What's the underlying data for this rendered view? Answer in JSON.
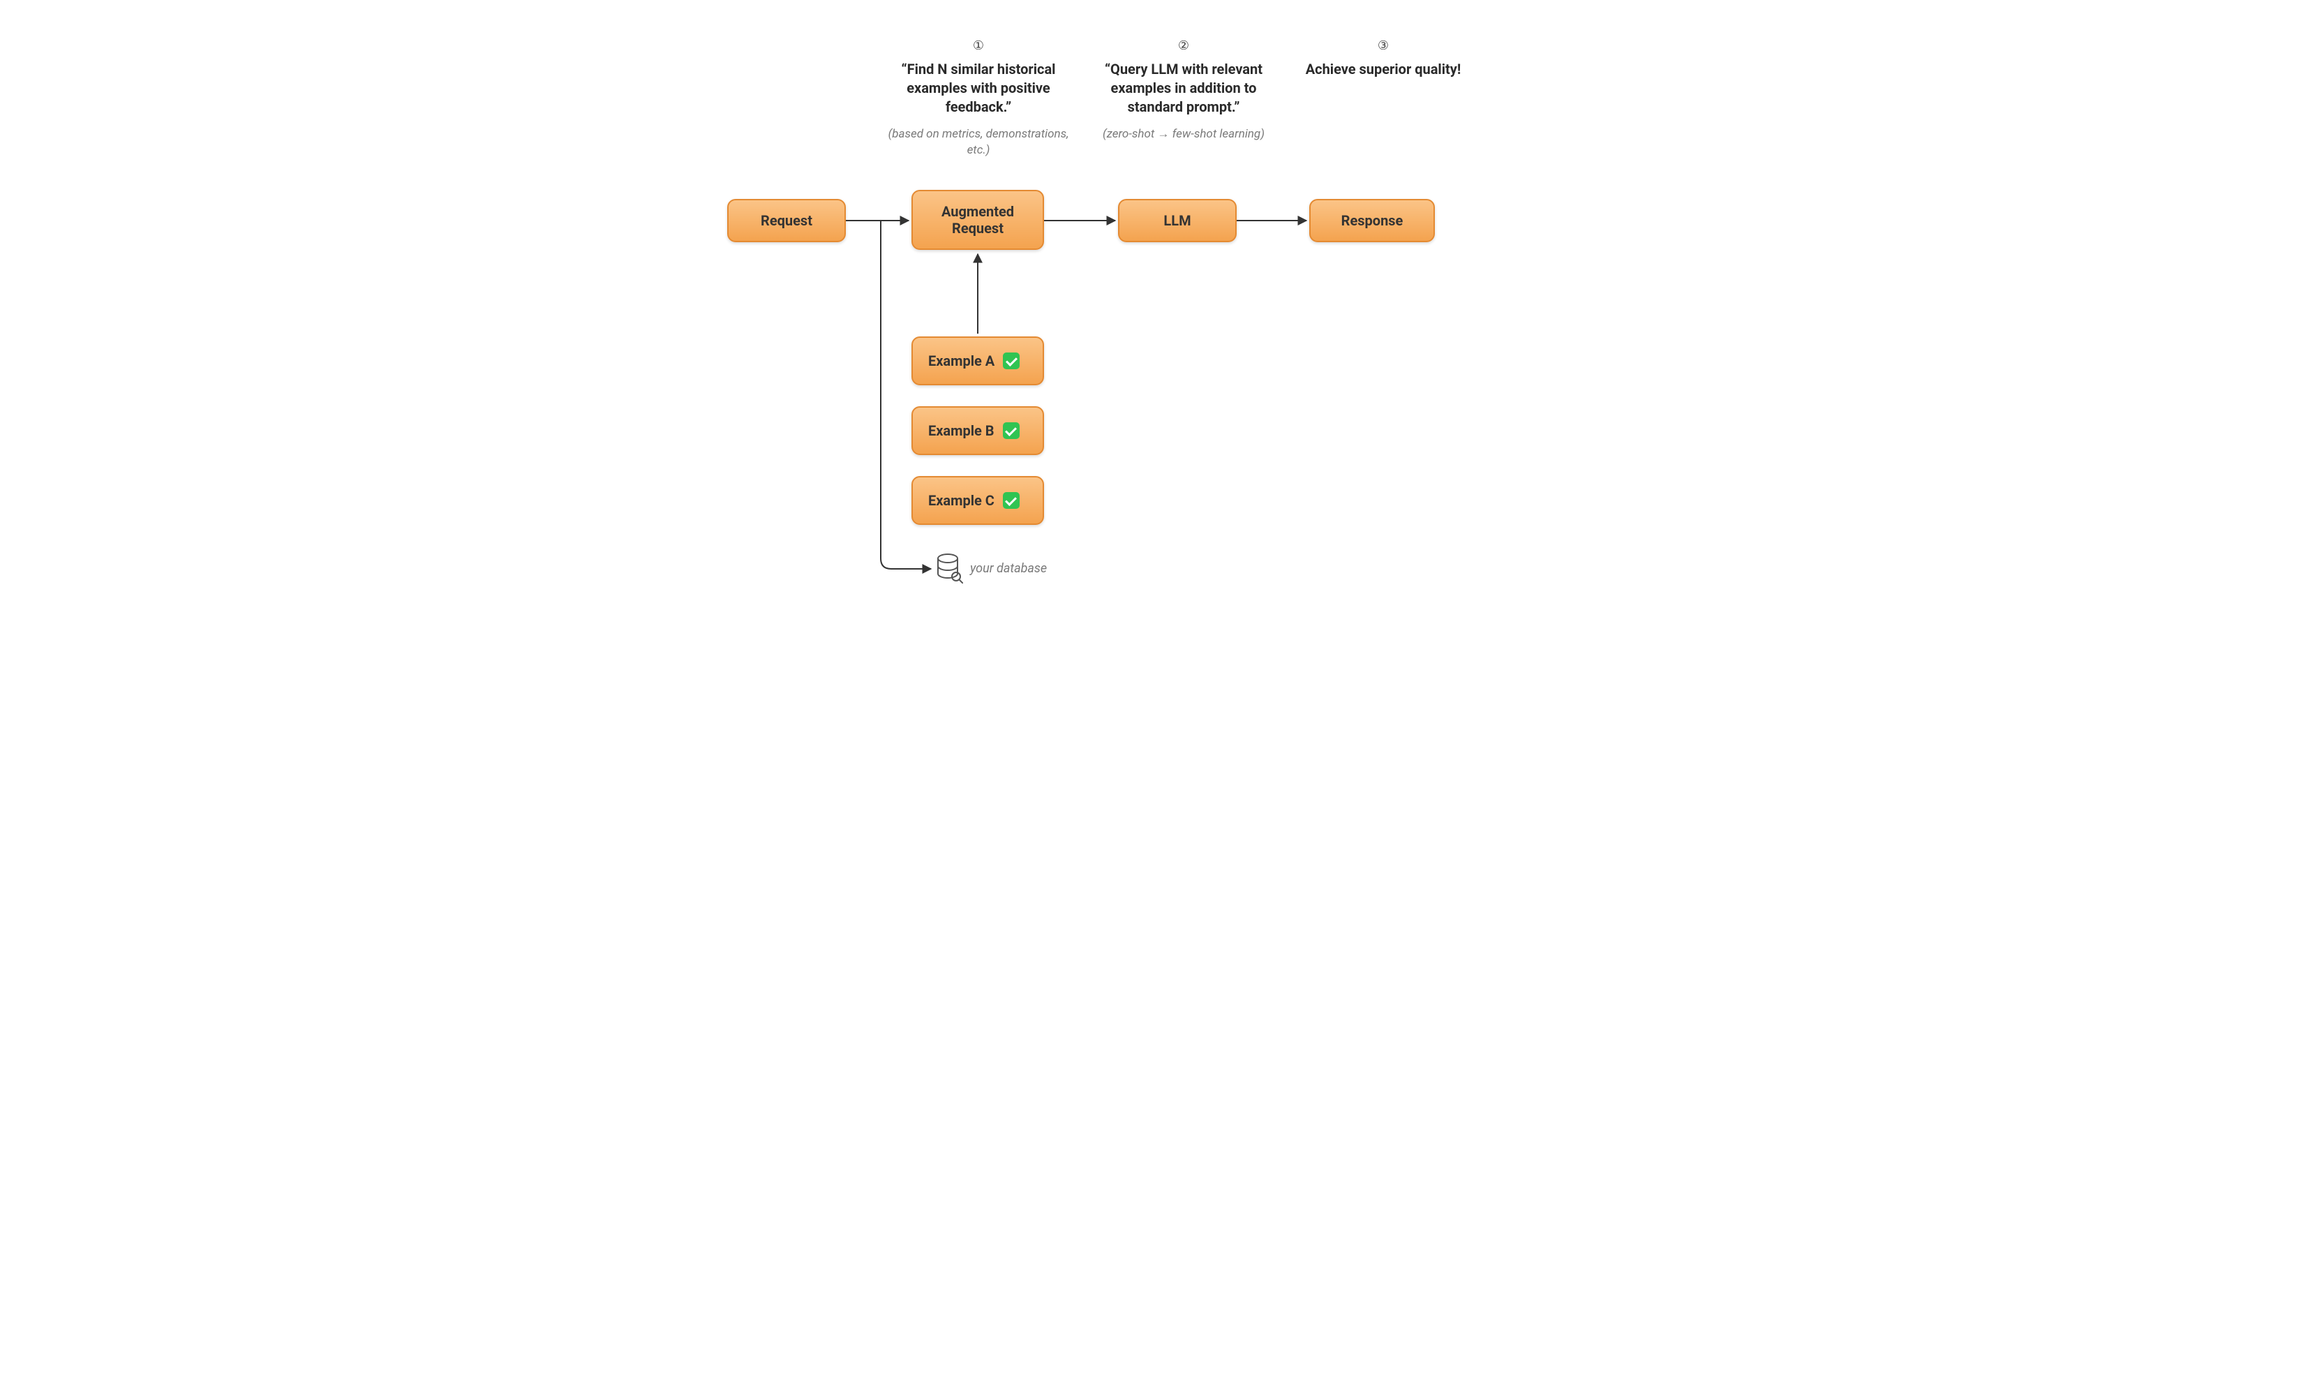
{
  "steps": [
    {
      "num": "①",
      "title": "“Find N similar historical examples with positive feedback.”",
      "sub": "(based on metrics, demonstrations, etc.)"
    },
    {
      "num": "②",
      "title": "“Query LLM with relevant examples in addition to standard prompt.”",
      "sub": "(zero-shot → few-shot learning)"
    },
    {
      "num": "③",
      "title": "Achieve superior quality!",
      "sub": ""
    }
  ],
  "nodes": {
    "request": "Request",
    "augmented": "Augmented Request",
    "llm": "LLM",
    "response": "Response",
    "exA": "Example A",
    "exB": "Example B",
    "exC": "Example C"
  },
  "db_label": "your database"
}
